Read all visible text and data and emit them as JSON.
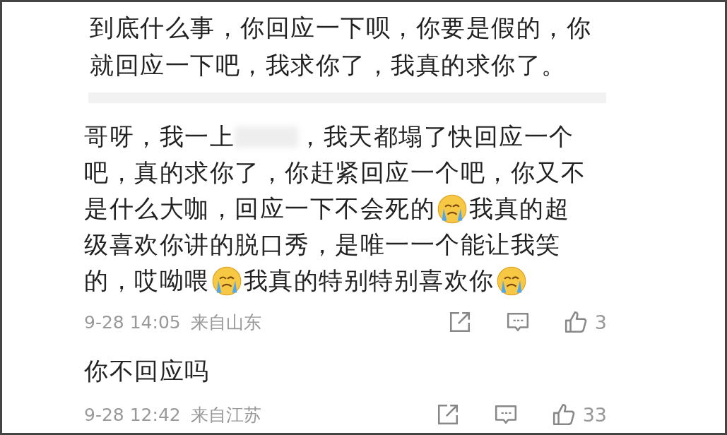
{
  "comments": [
    {
      "body": [
        [
          {
            "kind": "text",
            "text": "到底什么事，你回应一下呗，你要是假的，你"
          }
        ],
        [
          {
            "kind": "text",
            "text": "就回应一下吧，我求你了，我真的求你了。"
          }
        ]
      ]
    },
    {
      "body": [
        [
          {
            "kind": "text",
            "text": "哥呀，我一上"
          },
          {
            "kind": "redacted"
          },
          {
            "kind": "text",
            "text": "，我天都塌了快回应一个"
          }
        ],
        [
          {
            "kind": "text",
            "text": "吧，真的求你了，你赶紧回应一个吧，你又不"
          }
        ],
        [
          {
            "kind": "text",
            "text": "是什么大咖，回应一下不会死的"
          },
          {
            "kind": "emoji"
          },
          {
            "kind": "text",
            "text": "我真的超"
          }
        ],
        [
          {
            "kind": "text",
            "text": "级喜欢你讲的脱口秀，是唯一一个能让我笑"
          }
        ],
        [
          {
            "kind": "text",
            "text": "的，哎呦喂"
          },
          {
            "kind": "emoji"
          },
          {
            "kind": "text",
            "text": "我真的特别特别喜欢你"
          },
          {
            "kind": "emoji"
          }
        ]
      ],
      "meta": {
        "time": "9-28 14:05",
        "location": "来自山东",
        "likes": "3"
      }
    },
    {
      "body": [
        [
          {
            "kind": "text",
            "text": "你不回应吗"
          }
        ]
      ],
      "meta": {
        "time": "9-28 12:42",
        "location": "来自江苏",
        "likes": "33"
      }
    }
  ]
}
